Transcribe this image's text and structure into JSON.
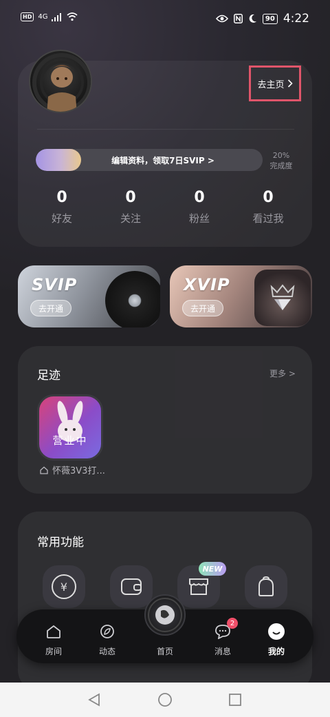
{
  "status_bar": {
    "hd": "HD",
    "network": "4G",
    "battery": "90",
    "time": "4:22"
  },
  "profile": {
    "home_link": "去主页",
    "progress": {
      "text": "编辑资料，领取7日SVIP >",
      "percent": "20%",
      "percent_label": "完成度",
      "fraction": 0.2
    },
    "stats": [
      {
        "value": "0",
        "label": "好友"
      },
      {
        "value": "0",
        "label": "关注"
      },
      {
        "value": "0",
        "label": "粉丝"
      },
      {
        "value": "0",
        "label": "看过我"
      }
    ]
  },
  "vip": {
    "svip": {
      "title": "SVIP",
      "button": "去开通"
    },
    "xvip": {
      "title": "XVIP",
      "button": "去开通"
    }
  },
  "footprint": {
    "title": "足迹",
    "more": "更多 >",
    "room": {
      "status": "营业中",
      "name": "怀薇3V3打..."
    }
  },
  "features": {
    "title": "常用功能",
    "new_badge": "NEW",
    "items": [
      {
        "label": "充值",
        "icon": "yen-icon"
      },
      {
        "label": "钱包",
        "icon": "wallet-icon"
      },
      {
        "label": "商城",
        "icon": "store-icon"
      },
      {
        "label": "背包",
        "icon": "backpack-icon"
      }
    ]
  },
  "tabbar": {
    "tabs": [
      {
        "label": "房间",
        "icon": "house-icon"
      },
      {
        "label": "动态",
        "icon": "leaf-icon"
      },
      {
        "label": "首页",
        "icon": "disc-icon"
      },
      {
        "label": "消息",
        "icon": "chat-icon",
        "badge": "2"
      },
      {
        "label": "我的",
        "icon": "smile-icon"
      }
    ],
    "active": "我的"
  }
}
